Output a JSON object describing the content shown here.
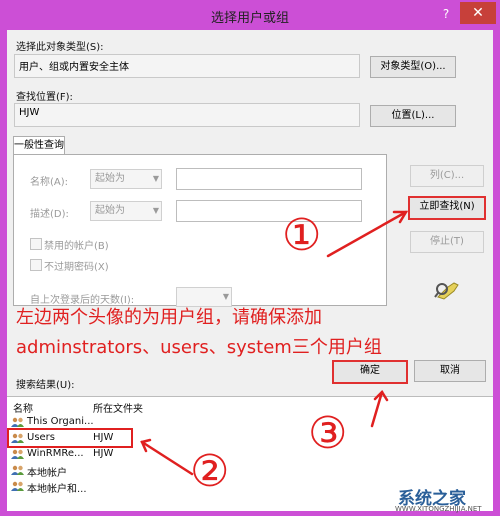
{
  "window": {
    "title": "选择用户或组",
    "help": "?",
    "close": "✕"
  },
  "object_type": {
    "label": "选择此对象类型(S):",
    "value": "用户、组或内置安全主体",
    "button": "对象类型(O)..."
  },
  "location": {
    "label": "查找位置(F):",
    "value": "HJW",
    "button": "位置(L)..."
  },
  "query": {
    "tab": "一般性查询",
    "name_label": "名称(A):",
    "name_mode": "起始为",
    "desc_label": "描述(D):",
    "desc_mode": "起始为",
    "disabled_label": "禁用的帐户(B)",
    "no_expire_label": "不过期密码(X)",
    "days_label": "自上次登录后的天数(I):",
    "columns_button": "列(C)...",
    "find_now_button": "立即查找(N)",
    "stop_button": "停止(T)"
  },
  "annotations": {
    "line1": "左边两个头像的为用户组，请确保添加",
    "line2": "adminstrators、users、system三个用户组",
    "mark1": "①",
    "mark2": "②",
    "mark3": "③"
  },
  "footer": {
    "results_label": "搜索结果(U):",
    "ok_button": "确定",
    "cancel_button": "取消"
  },
  "results": {
    "columns": [
      "名称",
      "所在文件夹"
    ],
    "rows": [
      {
        "name": "This Organi...",
        "folder": "",
        "icon": "group-icon"
      },
      {
        "name": "Users",
        "folder": "HJW",
        "icon": "group-icon"
      },
      {
        "name": "WinRMRe...",
        "folder": "HJW",
        "icon": "group-icon"
      },
      {
        "name": "本地帐户",
        "folder": "",
        "icon": "group-icon"
      },
      {
        "name": "本地帐户和...",
        "folder": "",
        "icon": "group-icon"
      }
    ]
  },
  "watermark": {
    "text": "系统之家",
    "sub": "WWW.XITONGZHIJIA.NET"
  },
  "colors": {
    "accent_frame": "#cc4fd6",
    "annotation": "#e02020",
    "close": "#c7403a"
  }
}
